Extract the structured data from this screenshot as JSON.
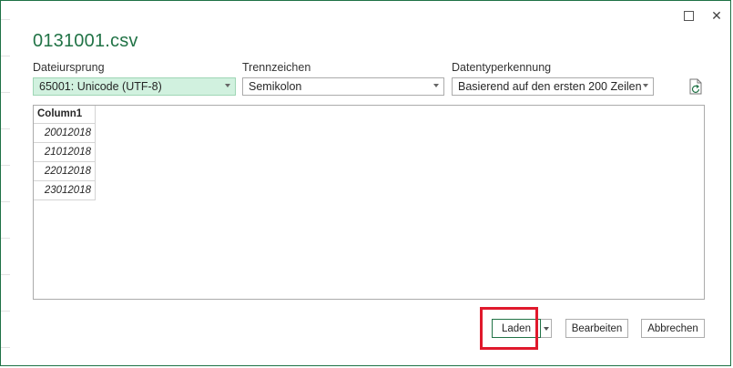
{
  "dialog": {
    "title": "0131001.csv",
    "close_glyph": "✕"
  },
  "fields": {
    "file_origin": {
      "label": "Dateiursprung",
      "value": "65001: Unicode (UTF-8)"
    },
    "delimiter": {
      "label": "Trennzeichen",
      "value": "Semikolon"
    },
    "data_type_detection": {
      "label": "Datentyperkennung",
      "value": "Basierend auf den ersten 200 Zeilen"
    }
  },
  "preview": {
    "columns": [
      "Column1"
    ],
    "rows": [
      [
        "20012018"
      ],
      [
        "21012018"
      ],
      [
        "22012018"
      ],
      [
        "23012018"
      ]
    ]
  },
  "buttons": {
    "load": "Laden",
    "edit": "Bearbeiten",
    "cancel": "Abbrechen"
  },
  "colors": {
    "accent": "#217346",
    "active_select_bg": "#d1f1df",
    "highlight": "#e0192c"
  },
  "icons": [
    "maximize-icon",
    "close-icon",
    "chevron-down-icon",
    "refresh-file-icon"
  ]
}
